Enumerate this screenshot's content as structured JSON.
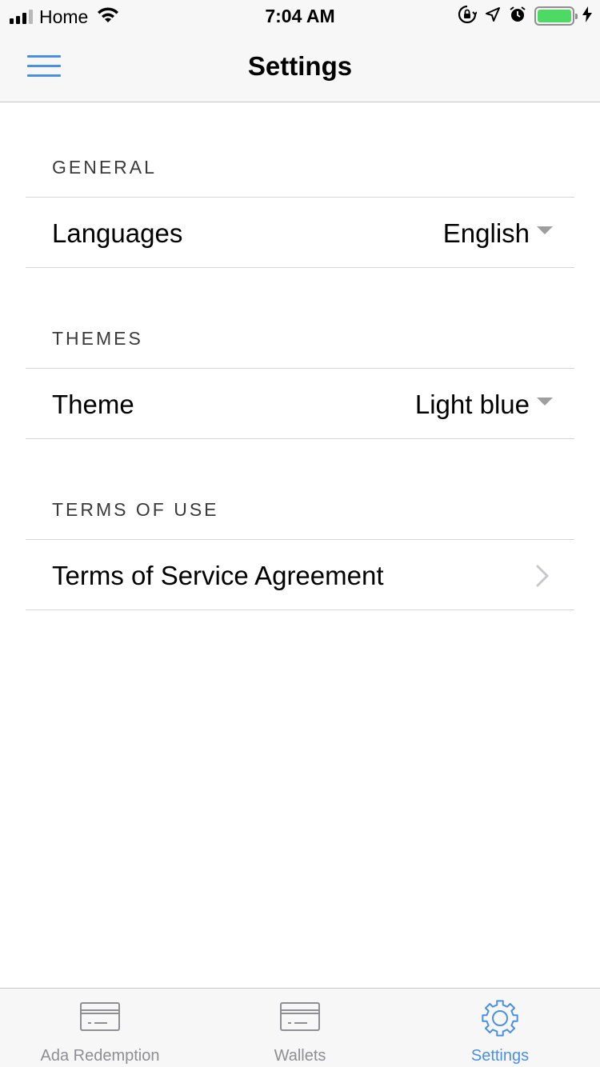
{
  "status_bar": {
    "carrier": "Home",
    "time": "7:04 AM",
    "signal_bars_filled": 3,
    "signal_bars_total": 4,
    "battery_level": 1.0,
    "icons": [
      "wifi-icon",
      "orientation-lock-icon",
      "location-arrow-icon",
      "alarm-icon",
      "battery-icon",
      "charging-bolt-icon"
    ]
  },
  "nav": {
    "title": "Settings",
    "menu_icon": "hamburger-menu-icon"
  },
  "sections": {
    "general": {
      "header": "GENERAL",
      "row_label": "Languages",
      "row_value": "English"
    },
    "themes": {
      "header": "THEMES",
      "row_label": "Theme",
      "row_value": "Light blue"
    },
    "terms": {
      "header": "TERMS OF USE",
      "row_label": "Terms of Service Agreement"
    }
  },
  "tabs": [
    {
      "label": "Ada Redemption",
      "icon": "card-icon",
      "active": false
    },
    {
      "label": "Wallets",
      "icon": "card-icon",
      "active": false
    },
    {
      "label": "Settings",
      "icon": "gear-icon",
      "active": true
    }
  ],
  "colors": {
    "accent": "#4a90e2",
    "inactive": "#8e8e93",
    "battery": "#4cd964",
    "bar_background": "#f7f7f7",
    "divider": "#d6d6d6"
  }
}
